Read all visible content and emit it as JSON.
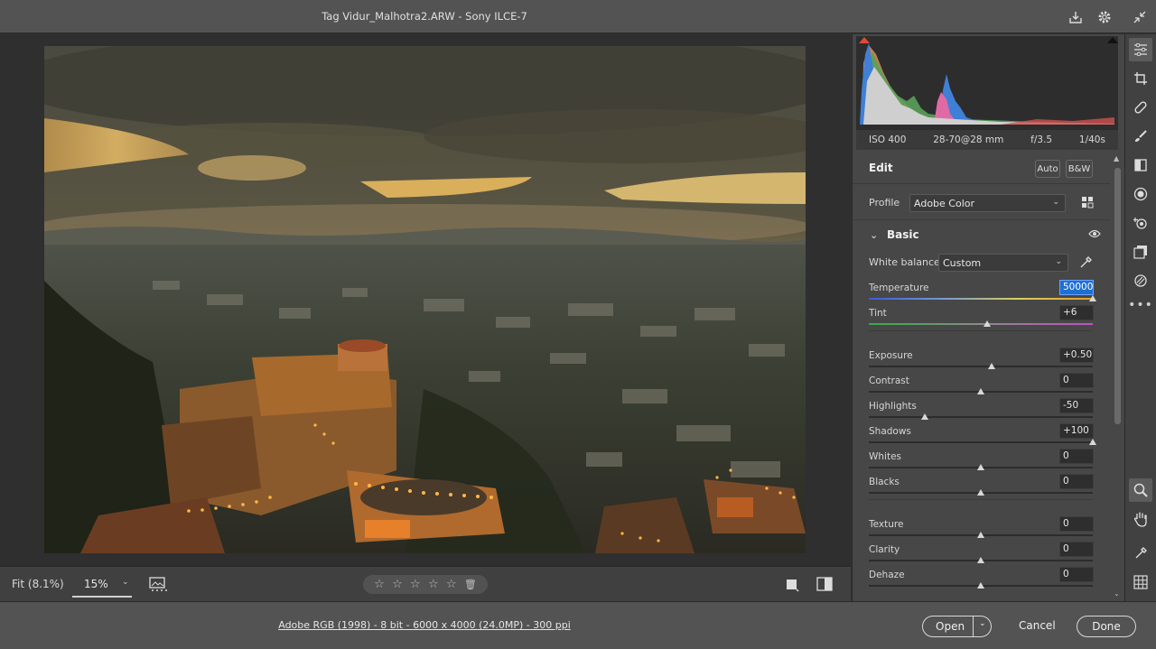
{
  "window": {
    "title": "Tag Vidur_Malhotra2.ARW  -  Sony ILCE-7"
  },
  "camera_info": {
    "iso": "ISO 400",
    "lens": "28-70@28 mm",
    "aperture": "f/3.5",
    "shutter": "1/40s"
  },
  "edit": {
    "heading": "Edit",
    "auto_label": "Auto",
    "bw_label": "B&W",
    "profile_label": "Profile",
    "profile_value": "Adobe Color"
  },
  "basic": {
    "section_title": "Basic",
    "white_balance_label": "White balance",
    "white_balance_value": "Custom",
    "sliders": [
      {
        "label": "Temperature",
        "value": "50000",
        "fraction": 1.0
      },
      {
        "label": "Tint",
        "value": "+6",
        "fraction": 0.53
      },
      {
        "label": "Exposure",
        "value": "+0.50",
        "fraction": 0.55
      },
      {
        "label": "Contrast",
        "value": "0",
        "fraction": 0.5
      },
      {
        "label": "Highlights",
        "value": "-50",
        "fraction": 0.25
      },
      {
        "label": "Shadows",
        "value": "+100",
        "fraction": 1.0
      },
      {
        "label": "Whites",
        "value": "0",
        "fraction": 0.5
      },
      {
        "label": "Blacks",
        "value": "0",
        "fraction": 0.5
      },
      {
        "label": "Texture",
        "value": "0",
        "fraction": 0.5
      },
      {
        "label": "Clarity",
        "value": "0",
        "fraction": 0.5
      },
      {
        "label": "Dehaze",
        "value": "0",
        "fraction": 0.5
      }
    ]
  },
  "view": {
    "fit_label": "Fit (8.1%)",
    "zoom_value": "15%"
  },
  "footer": {
    "file_info": "Adobe RGB (1998) - 8 bit - 6000 x 4000 (24.0MP) - 300 ppi",
    "open_label": "Open",
    "cancel_label": "Cancel",
    "done_label": "Done"
  },
  "colors": {
    "accent": "#1f6fd1",
    "panel": "#474747",
    "topbar": "#535353"
  },
  "icons": {
    "tools": [
      "edit-sliders-icon",
      "crop-icon",
      "healing-icon",
      "brush-icon",
      "linear-gradient-icon",
      "radial-filter-icon",
      "red-eye-icon",
      "presets-icon",
      "snapshots-icon",
      "more-icon"
    ],
    "bottom_tools": [
      "zoom-icon",
      "hand-icon",
      "color-sampler-icon",
      "grid-icon"
    ]
  }
}
